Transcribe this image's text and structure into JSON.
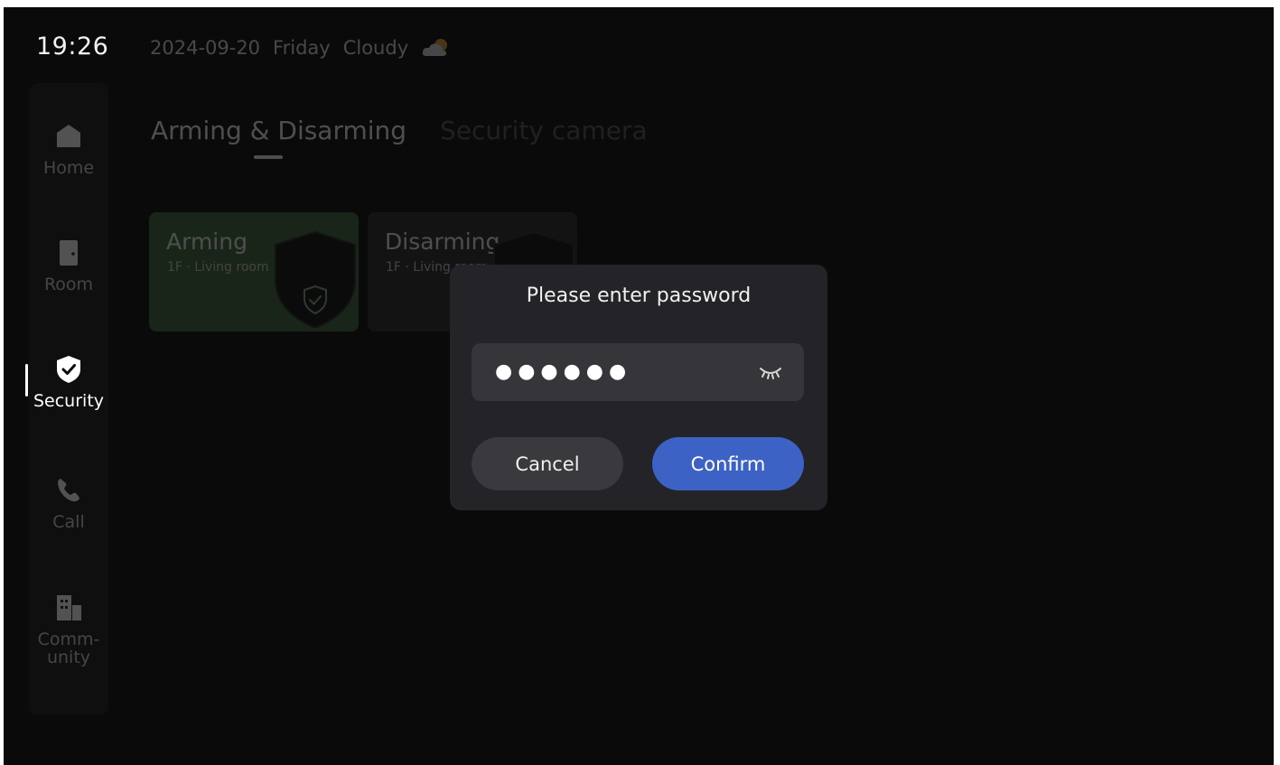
{
  "status_bar": {
    "time": "19:26",
    "date": "2024-09-20",
    "weekday": "Friday",
    "weather": "Cloudy",
    "weather_icon": "cloud-sun-icon"
  },
  "sidebar": {
    "items": [
      {
        "label": "Home",
        "icon": "home-icon",
        "active": false
      },
      {
        "label": "Room",
        "icon": "door-icon",
        "active": false
      },
      {
        "label": "Security",
        "icon": "shield-check-icon",
        "active": true
      },
      {
        "label": "Call",
        "icon": "phone-icon",
        "active": false
      },
      {
        "label": "Comm-\nunity",
        "icon": "building-icon",
        "active": false
      }
    ]
  },
  "tabs": [
    {
      "label": "Arming & Disarming",
      "active": true
    },
    {
      "label": "Security camera",
      "active": false
    }
  ],
  "cards": [
    {
      "title": "Arming",
      "subtitle": "1F · Living room",
      "color": "#3f6a3e"
    },
    {
      "title": "Disarming",
      "subtitle": "1F · Living room",
      "color": "#2c2c2f"
    }
  ],
  "dialog": {
    "title": "Please enter password",
    "password_masked": "●●●●●●",
    "visibility_icon": "eye-closed-icon",
    "cancel_label": "Cancel",
    "confirm_label": "Confirm",
    "confirm_color": "#3b62c4"
  }
}
